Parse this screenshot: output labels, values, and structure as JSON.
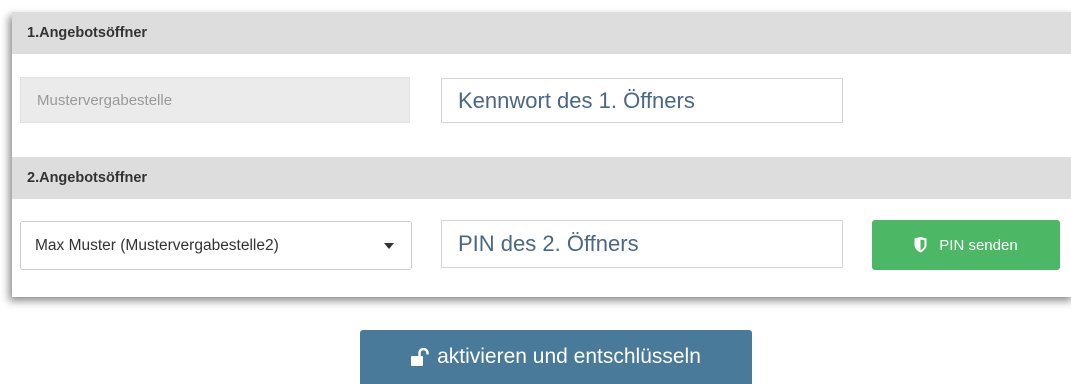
{
  "section1": {
    "header": "1.Angebotsöffner",
    "organisation_value": "Mustervergabestelle",
    "password_placeholder": "Kennwort des 1. Öffners"
  },
  "section2": {
    "header": "2.Angebotsöffner",
    "selected_person": "Max Muster (Mustervergabestelle2)",
    "pin_placeholder": "PIN des 2. Öffners",
    "pin_button_label": "PIN senden",
    "pin_button_icon": "shield-icon",
    "pin_button_color": "#4cb865"
  },
  "action": {
    "label": "aktivieren und entschlüsseln",
    "icon": "unlock-icon",
    "color": "#4a7a99"
  }
}
